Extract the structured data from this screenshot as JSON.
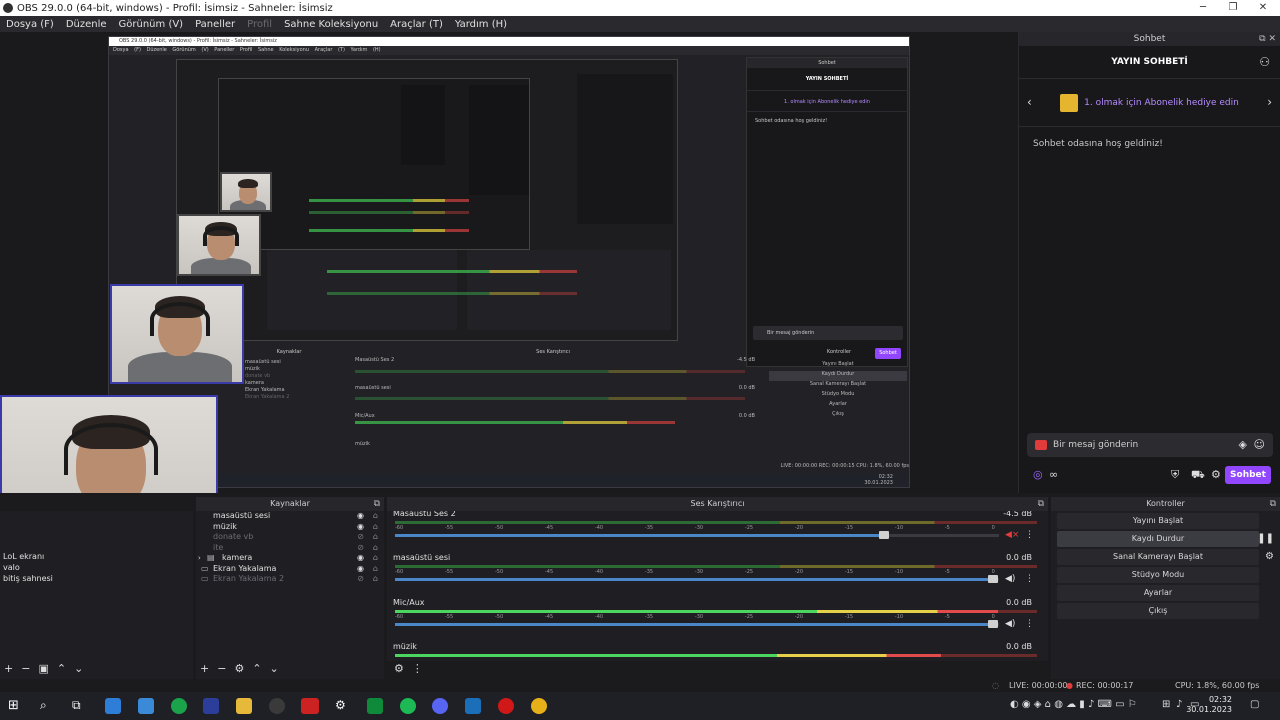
{
  "window": {
    "title": "OBS 29.0.0 (64-bit, windows) - Profil: İsimsiz - Sahneler: İsimsiz",
    "controls": {
      "minimize": "─",
      "restore": "❐",
      "close": "✕"
    }
  },
  "menu": {
    "items": [
      "Dosya (F)",
      "Düzenle",
      "Görünüm (V)",
      "Paneller",
      "Profil",
      "Sahne Koleksiyonu",
      "Araçlar (T)",
      "Yardım (H)"
    ]
  },
  "chat": {
    "dock_title": "Sohbet",
    "header": "YAYIN SOHBETİ",
    "gift_text": "1. olmak için Abonelik hediye edin",
    "welcome": "Sohbet odasına hoş geldiniz!",
    "input_placeholder": "Bir mesaj gönderin",
    "send_label": "Sohbet",
    "inf": "∞"
  },
  "docks": {
    "sources_title": "Kaynaklar",
    "mixer_title": "Ses Karıştırıcı",
    "controls_title": "Kontroller"
  },
  "scenes": {
    "items": [
      "LoL ekranı",
      "valo",
      "bitiş sahnesi"
    ]
  },
  "sources": {
    "items": [
      {
        "name": "masaüstü sesi"
      },
      {
        "name": "müzik"
      },
      {
        "name": "donate vb"
      },
      {
        "name": "ite"
      },
      {
        "name": "kamera"
      },
      {
        "name": "Ekran Yakalama"
      },
      {
        "name": "Ekran Yakalama 2"
      }
    ]
  },
  "mixer": {
    "tracks": [
      {
        "name": "Masaüstü Ses 2",
        "db": "-4.5 dB",
        "level": 0.0,
        "volume": 0.81,
        "muted": true
      },
      {
        "name": "masaüstü sesi",
        "db": "0.0 dB",
        "level": 0.0,
        "volume": 0.99,
        "muted": false
      },
      {
        "name": "Mic/Aux",
        "db": "0.0 dB",
        "level": 0.94,
        "volume": 0.99,
        "muted": false
      },
      {
        "name": "müzik",
        "db": "0.0 dB",
        "level": 0.85,
        "volume": 0.99,
        "muted": false
      }
    ],
    "ticks": [
      "-60",
      "-55",
      "-50",
      "-45",
      "-40",
      "-35",
      "-30",
      "-25",
      "-20",
      "-15",
      "-10",
      "-5",
      "0"
    ]
  },
  "controls": {
    "buttons": [
      "Yayını Başlat",
      "Kaydı Durdur",
      "Sanal Kamerayı Başlat",
      "Stüdyo Modu",
      "Ayarlar",
      "Çıkış"
    ]
  },
  "status": {
    "live": "LIVE: 00:00:00",
    "rec": "REC: 00:00:17",
    "cpu": "CPU: 1.8%, 60.00 fps"
  },
  "taskbar": {
    "time": "02:32",
    "date": "30.01.2023"
  },
  "nested": {
    "title": "OBS 29.0.0 (64-bit, windows) - Profil: İsimsiz - Sahneler: İsimsiz",
    "menu": "Dosya (F) Düzenle Görünüm (V) Paneller Profil Sahne Koleksiyonu Araçlar (T) Yardım (H)",
    "chat_title": "Sohbet",
    "chat_header": "YAYIN SOHBETİ",
    "gift": "1. olmak için Abonelik hediye edin",
    "welcome": "Sohbet odasına hoş geldiniz!",
    "input": "Bir mesaj gönderin",
    "send": "Sohbet",
    "sources": "Kaynaklar",
    "mixer": "Ses Karıştırıcı",
    "controls": "Kontroller",
    "buttons": [
      "Yayını Başlat",
      "Kaydı Durdur",
      "Sanal Kamerayı Başlat",
      "Stüdyo Modu",
      "Ayarlar",
      "Çıkış"
    ],
    "src_items": [
      "masaüstü sesi",
      "müzik",
      "donate vb",
      "kamera",
      "Ekran Yakalama",
      "Ekran Yakalama 2"
    ],
    "mix_names": [
      "Masaüstü Ses 2",
      "masaüstü sesi",
      "Mic/Aux",
      "müzik"
    ],
    "dbs": [
      "-4.5 dB",
      "0.0 dB",
      "0.0 dB",
      "0.0 dB"
    ],
    "status": "LIVE: 00:00:00   REC: 00:00:15   CPU: 1.8%, 60.00 fps",
    "time": "02:32",
    "date": "30.01.2023"
  },
  "colors": {
    "accent": "#9147ff",
    "gift": "#b58bff",
    "rec": "#e23b3b",
    "slider": "#4a86c8"
  }
}
